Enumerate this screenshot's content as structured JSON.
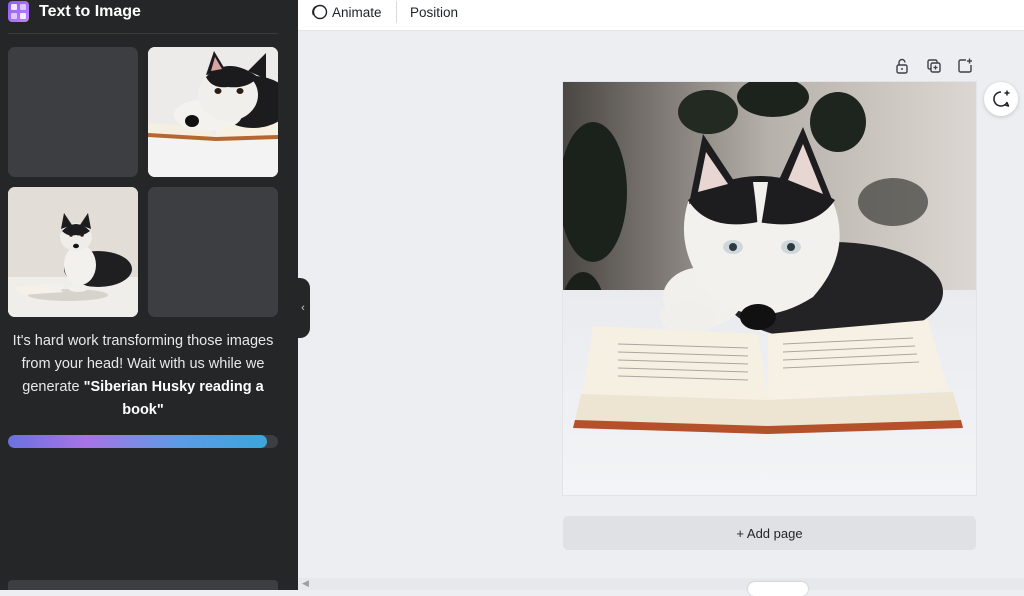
{
  "panel": {
    "title": "Text to Image",
    "status_prefix": "It's hard work transforming those images from your head! Wait with us while we generate ",
    "status_quote_open": "\"",
    "prompt": "Siberian Husky reading a book",
    "status_quote_close": "\"",
    "progress_fraction": 0.96,
    "thumbnails": [
      {
        "state": "loading"
      },
      {
        "state": "image",
        "subject": "husky lying on book"
      },
      {
        "state": "image",
        "subject": "husky sitting with book"
      },
      {
        "state": "loading"
      }
    ]
  },
  "toolbar": {
    "animate_label": "Animate",
    "position_label": "Position"
  },
  "canvas": {
    "add_page_label": "+ Add page",
    "page_icons": [
      "lock-icon",
      "duplicate-icon",
      "add-page-icon"
    ],
    "comment_icon": "comment-add-icon"
  },
  "colors": {
    "panel_bg": "#252627",
    "canvas_bg": "#eceef1",
    "progress_gradient": [
      "#6a72e0",
      "#a873e6",
      "#5d9be6",
      "#3ba6dc"
    ]
  }
}
